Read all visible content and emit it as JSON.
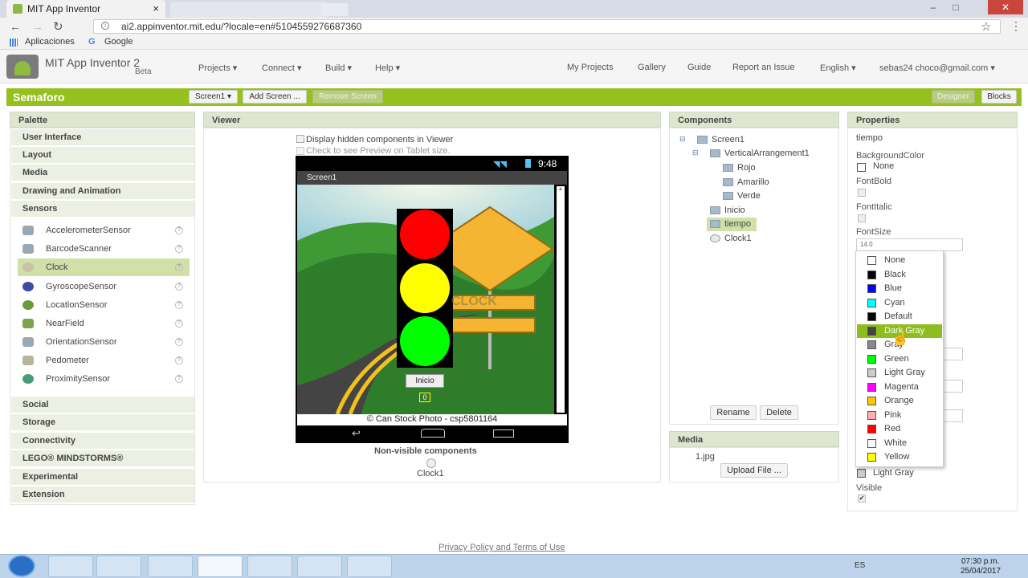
{
  "browser": {
    "tab_title": "MIT App Inventor",
    "tab_close": "×",
    "url": "ai2.appinventor.mit.edu/?locale=en#5104559276687360",
    "bookmarks": [
      "Aplicaciones",
      "Google"
    ],
    "window_controls": [
      "–",
      "□",
      "✕"
    ]
  },
  "header": {
    "title": "MIT App Inventor 2",
    "beta": "Beta",
    "menus": [
      "Projects ▾",
      "Connect ▾",
      "Build ▾",
      "Help ▾"
    ],
    "links": [
      "My Projects",
      "Gallery",
      "Guide",
      "Report an Issue",
      "English ▾",
      "sebas24 choco@gmail.com ▾"
    ]
  },
  "toolbar": {
    "project": "Semaforo",
    "screen_select": "Screen1 ▾",
    "add_screen": "Add Screen ...",
    "remove_screen": "Remove Screen",
    "designer": "Designer",
    "blocks": "Blocks"
  },
  "palette": {
    "title": "Palette",
    "categories_top": [
      "User Interface",
      "Layout",
      "Media",
      "Drawing and Animation",
      "Sensors"
    ],
    "sensors": [
      "AccelerometerSensor",
      "BarcodeScanner",
      "Clock",
      "GyroscopeSensor",
      "LocationSensor",
      "NearField",
      "OrientationSensor",
      "Pedometer",
      "ProximitySensor"
    ],
    "categories_bottom": [
      "Social",
      "Storage",
      "Connectivity",
      "LEGO® MINDSTORMS®",
      "Experimental",
      "Extension"
    ]
  },
  "viewer": {
    "title": "Viewer",
    "check_hidden": "Display hidden components in Viewer",
    "check_tablet": "Check to see Preview on Tablet size.",
    "status_time": "9:48",
    "screen_title": "Screen1",
    "button_label": "Inicio",
    "counter": "0",
    "watermark": "CLOCK",
    "caption": "© Can Stock Photo - csp5801164",
    "nonvisible_title": "Non-visible components",
    "nonvisible_item": "Clock1"
  },
  "components": {
    "title": "Components",
    "tree": [
      "Screen1",
      "VerticalArrangement1",
      "Rojo",
      "Amarillo",
      "Verde",
      "Inicio",
      "tiempo",
      "Clock1"
    ],
    "toggle": "⊟",
    "rename": "Rename",
    "delete": "Delete"
  },
  "media": {
    "title": "Media",
    "file": "1.jpg",
    "upload": "Upload File ..."
  },
  "properties": {
    "title": "Properties",
    "component": "tiempo",
    "background_label": "BackgroundColor",
    "background_value": "None",
    "fontbold_label": "FontBold",
    "fontitalic_label": "FontItalic",
    "fontsize_label": "FontSize",
    "fontsize_value": "14.0",
    "textcolor_value": "Light Gray",
    "visible_label": "Visible",
    "visible_check": "✔"
  },
  "color_options": [
    {
      "name": "None",
      "color": "#ffffff"
    },
    {
      "name": "Black",
      "color": "#000000"
    },
    {
      "name": "Blue",
      "color": "#0000ff"
    },
    {
      "name": "Cyan",
      "color": "#00ffff"
    },
    {
      "name": "Default",
      "color": "#000000"
    },
    {
      "name": "Dark Gray",
      "color": "#444444"
    },
    {
      "name": "Gray",
      "color": "#888888"
    },
    {
      "name": "Green",
      "color": "#00ff00"
    },
    {
      "name": "Light Gray",
      "color": "#cccccc"
    },
    {
      "name": "Magenta",
      "color": "#ff00ff"
    },
    {
      "name": "Orange",
      "color": "#ffc800"
    },
    {
      "name": "Pink",
      "color": "#ffafaf"
    },
    {
      "name": "Red",
      "color": "#ff0000"
    },
    {
      "name": "White",
      "color": "#ffffff"
    },
    {
      "name": "Yellow",
      "color": "#ffff00"
    }
  ],
  "selected_color": "Dark Gray",
  "footer": {
    "link": "Privacy Policy and Terms of Use"
  },
  "taskbar": {
    "lang": "ES",
    "time": "07:30 p.m.",
    "date": "25/04/2017"
  }
}
